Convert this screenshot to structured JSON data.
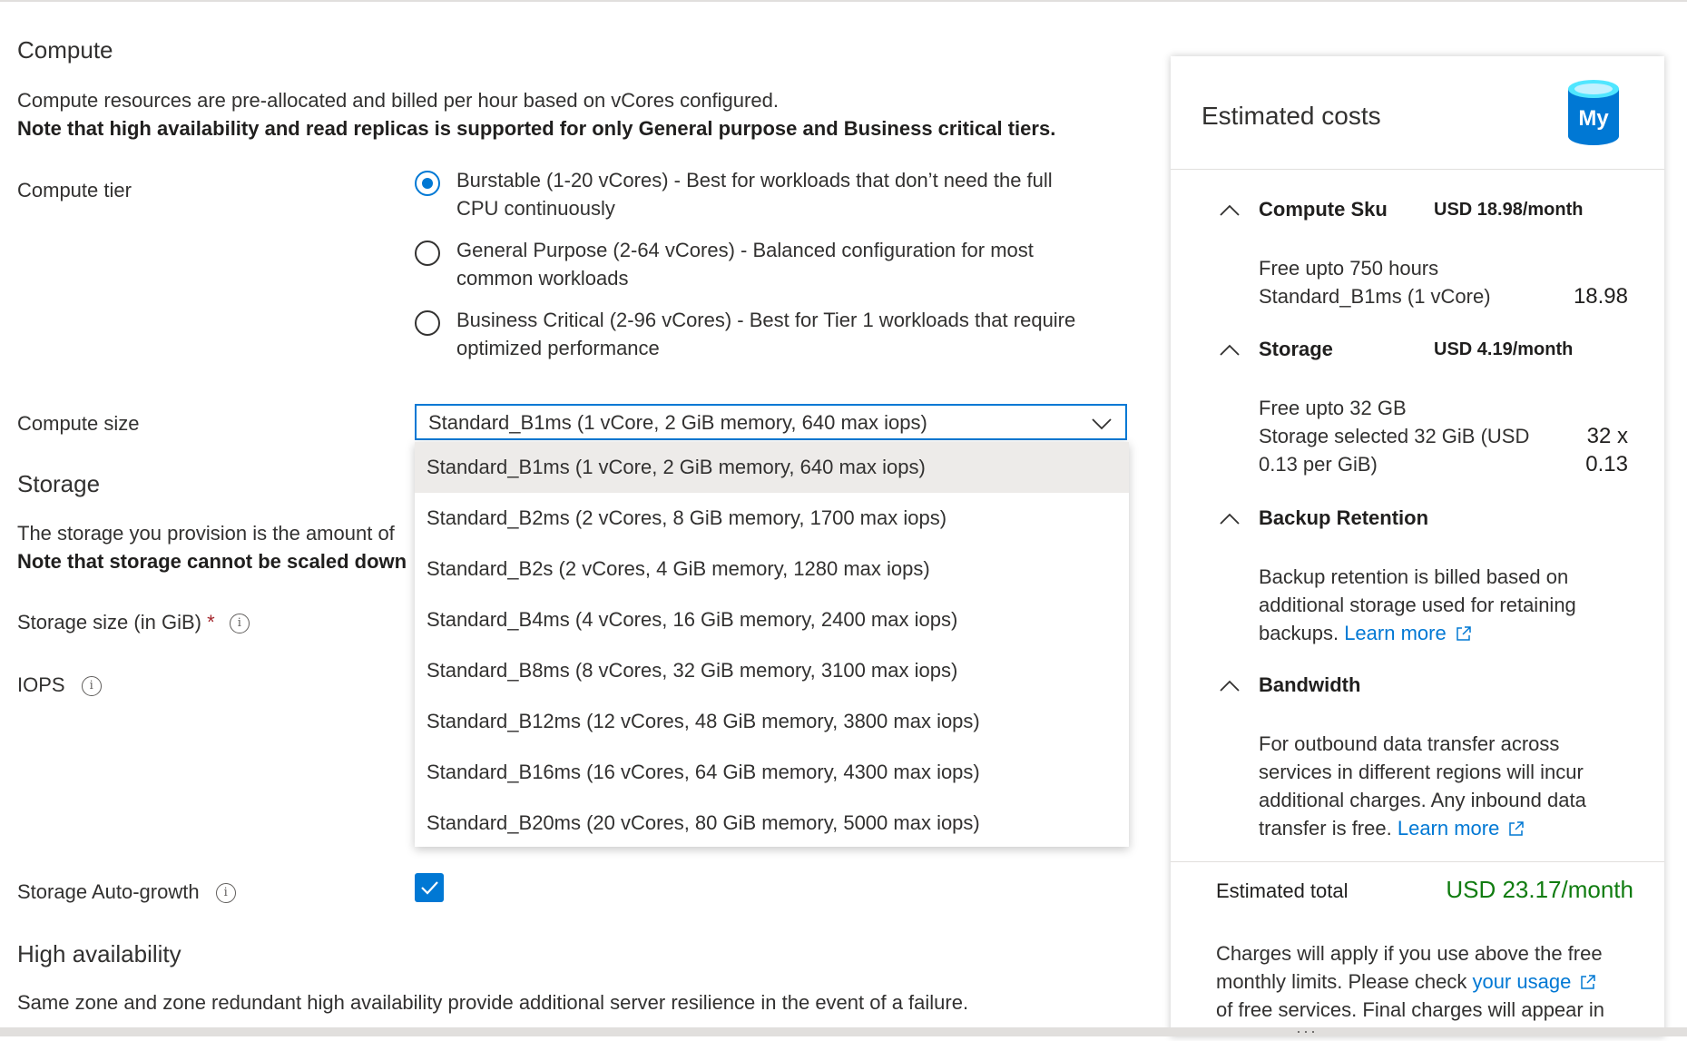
{
  "compute": {
    "heading": "Compute",
    "desc": "Compute resources are pre-allocated and billed per hour based on vCores configured.",
    "note": "Note that high availability and read replicas is supported for only General purpose and Business critical tiers.",
    "tier_label": "Compute tier",
    "tiers": [
      {
        "label": "Burstable (1-20 vCores) - Best for workloads that don’t need the full CPU continuously",
        "selected": true
      },
      {
        "label": "General Purpose (2-64 vCores) - Balanced configuration for most common workloads",
        "selected": false
      },
      {
        "label": "Business Critical (2-96 vCores) - Best for Tier 1 workloads that require optimized performance",
        "selected": false
      }
    ],
    "size_label": "Compute size",
    "size_value": "Standard_B1ms (1 vCore, 2 GiB memory, 640 max iops)",
    "size_options": [
      "Standard_B1ms (1 vCore, 2 GiB memory, 640 max iops)",
      "Standard_B2ms (2 vCores, 8 GiB memory, 1700 max iops)",
      "Standard_B2s (2 vCores, 4 GiB memory, 1280 max iops)",
      "Standard_B4ms (4 vCores, 16 GiB memory, 2400 max iops)",
      "Standard_B8ms (8 vCores, 32 GiB memory, 3100 max iops)",
      "Standard_B12ms (12 vCores, 48 GiB memory, 3800 max iops)",
      "Standard_B16ms (16 vCores, 64 GiB memory, 4300 max iops)",
      "Standard_B20ms (20 vCores, 80 GiB memory, 5000 max iops)"
    ]
  },
  "storage": {
    "heading": "Storage",
    "desc_partial": "The storage you provision is the amount of",
    "note_partial": "Note that storage cannot be scaled down",
    "size_label": "Storage size (in GiB)",
    "required_mark": "*",
    "iops_label": "IOPS",
    "autogrowth_label": "Storage Auto-growth",
    "autogrowth_checked": true
  },
  "ha": {
    "heading": "High availability",
    "desc": "Same zone and zone redundant high availability provide additional server resilience in the event of a failure."
  },
  "costs": {
    "title": "Estimated costs",
    "logo_text": "My",
    "compute_sku": {
      "name": "Compute Sku",
      "price": "USD 18.98/month",
      "free": "Free upto 750 hours",
      "line": "Standard_B1ms (1 vCore)",
      "value": "18.98"
    },
    "storage": {
      "name": "Storage",
      "price": "USD 4.19/month",
      "free": "Free upto 32 GB",
      "line1": "Storage selected 32 GiB (USD",
      "line2": "0.13 per GiB)",
      "value1": "32 x",
      "value2": "0.13"
    },
    "backup": {
      "name": "Backup Retention",
      "line1": "Backup retention is billed based on",
      "line2": "additional storage used for retaining",
      "line3": "backups.",
      "link": "Learn more"
    },
    "bandwidth": {
      "name": "Bandwidth",
      "line1": "For outbound data transfer across",
      "line2": "services in different regions will incur",
      "line3": "additional charges. Any inbound data",
      "line4": "transfer is free.",
      "link": "Learn more"
    },
    "total_label": "Estimated total",
    "total_value": "USD 23.17/month",
    "footer_line1": "Charges will apply if you use above the free",
    "footer_line2": "monthly limits. Please check",
    "footer_link": "your usage",
    "footer_line3": "of free services. Final charges will appear in"
  },
  "colors": {
    "accent": "#0078d4",
    "green": "#107c10",
    "required": "#a4262c"
  }
}
